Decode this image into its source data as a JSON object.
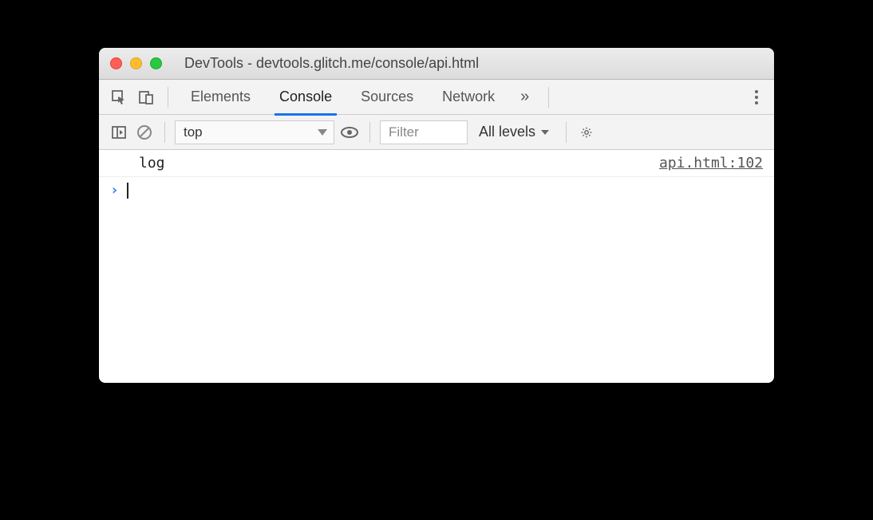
{
  "window": {
    "title": "DevTools - devtools.glitch.me/console/api.html"
  },
  "tabs": {
    "elements": "Elements",
    "console": "Console",
    "sources": "Sources",
    "network": "Network"
  },
  "subbar": {
    "context": "top",
    "filter_placeholder": "Filter",
    "levels": "All levels"
  },
  "console": {
    "entries": [
      {
        "text": "log",
        "source": "api.html:102"
      }
    ],
    "prompt": "›"
  }
}
